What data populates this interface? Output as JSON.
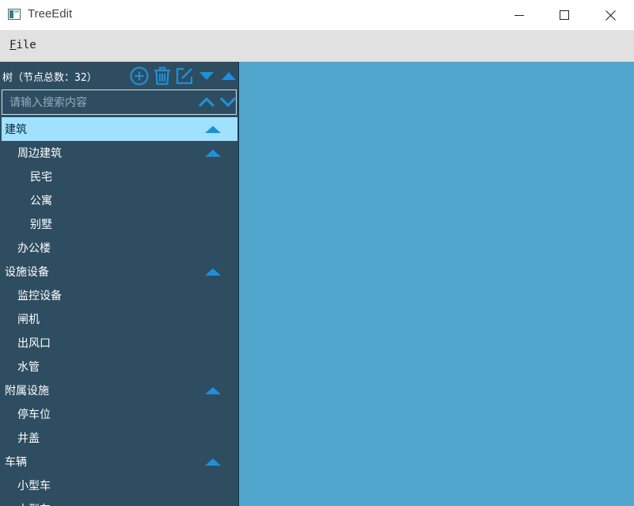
{
  "window": {
    "title": "TreeEdit"
  },
  "menu": {
    "file_u": "F",
    "file_rest": "ile"
  },
  "panel": {
    "title": "树（节点总数：32）",
    "search_placeholder": "请输入搜索内容"
  },
  "tree": [
    {
      "label": "建筑",
      "level": 0,
      "expanded": true,
      "selected": true
    },
    {
      "label": "周边建筑",
      "level": 1,
      "expanded": true
    },
    {
      "label": "民宅",
      "level": 2
    },
    {
      "label": "公寓",
      "level": 2
    },
    {
      "label": "别墅",
      "level": 2
    },
    {
      "label": "办公楼",
      "level": 1
    },
    {
      "label": "设施设备",
      "level": 0,
      "expanded": true
    },
    {
      "label": "监控设备",
      "level": 1
    },
    {
      "label": "闸机",
      "level": 1
    },
    {
      "label": "出风口",
      "level": 1
    },
    {
      "label": "水管",
      "level": 1
    },
    {
      "label": "附属设施",
      "level": 0,
      "expanded": true
    },
    {
      "label": "停车位",
      "level": 1
    },
    {
      "label": "井盖",
      "level": 1
    },
    {
      "label": "车辆",
      "level": 0,
      "expanded": true
    },
    {
      "label": "小型车",
      "level": 1
    },
    {
      "label": "大型车",
      "level": 1
    }
  ],
  "colors": {
    "accent": "#1e90d8",
    "panel_bg": "#2e4d60",
    "main_bg": "#50a6cc",
    "selected_bg": "#9fe1ff"
  }
}
